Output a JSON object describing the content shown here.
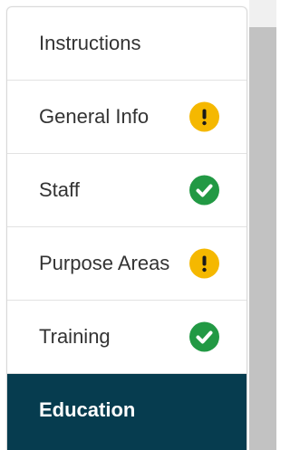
{
  "nav": {
    "items": [
      {
        "label": "Instructions",
        "status": "none"
      },
      {
        "label": "General Info",
        "status": "warning",
        "status_icon": "exclamation-icon",
        "status_color": "#f5b800"
      },
      {
        "label": "Staff",
        "status": "complete",
        "status_icon": "checkmark-icon",
        "status_color": "#229944"
      },
      {
        "label": "Purpose Areas",
        "status": "warning",
        "status_icon": "exclamation-icon",
        "status_color": "#f5b800"
      },
      {
        "label": "Training",
        "status": "complete",
        "status_icon": "checkmark-icon",
        "status_color": "#229944"
      },
      {
        "label": "Education",
        "status": "active"
      }
    ],
    "active_color": "#063c4f"
  }
}
